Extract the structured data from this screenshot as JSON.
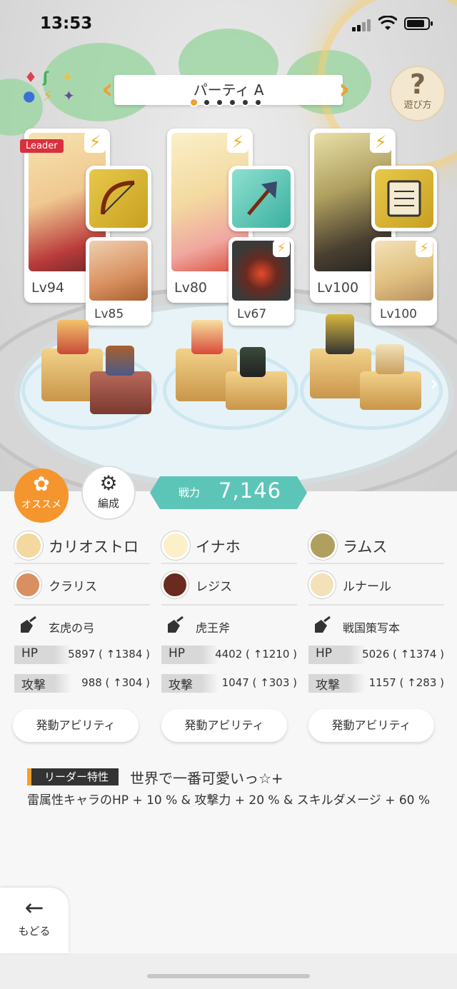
{
  "status_bar": {
    "time": "13:53"
  },
  "party": {
    "name": "パーティ A",
    "page_index": 1,
    "page_count": 6,
    "help_label": "遊び方",
    "prev_symbol": "‹",
    "next_symbol": "›",
    "help_symbol": "?"
  },
  "leader_tag": "Leader",
  "power": {
    "label": "戦力",
    "value": "7,146"
  },
  "buttons": {
    "recommend": "オススメ",
    "formation": "編成",
    "back": "もどる",
    "ability": "発動アビリティ"
  },
  "units": [
    {
      "name": "カリオストロ",
      "level": "Lv94",
      "sub_name": "クラリス",
      "sub_level": "Lv85",
      "weapon": "玄虎の弓",
      "hp_label": "HP",
      "hp": "5897 ( ↑1384 )",
      "atk_label": "攻撃",
      "atk": "988 ( ↑304 )"
    },
    {
      "name": "イナホ",
      "level": "Lv80",
      "sub_name": "レジス",
      "sub_level": "Lv67",
      "weapon": "虎王斧",
      "hp_label": "HP",
      "hp": "4402 ( ↑1210 )",
      "atk_label": "攻撃",
      "atk": "1047 ( ↑303 )"
    },
    {
      "name": "ラムス",
      "level": "Lv100",
      "sub_name": "ルナール",
      "sub_level": "Lv100",
      "weapon": "戦国策写本",
      "hp_label": "HP",
      "hp": "5026 ( ↑1374 )",
      "atk_label": "攻撃",
      "atk": "1157 ( ↑283 )"
    }
  ],
  "leader_skill": {
    "label": "リーダー特性",
    "name": "世界で一番可愛いっ☆+",
    "description": "雷属性キャラのHP + 10 % & 攻撃力 + 20 % & スキルダメージ + 60 %"
  },
  "icons": {
    "element": "bolt-icon",
    "weapon": "weapon-icon",
    "back": "arrow-left-icon",
    "help": "question-icon"
  },
  "colors": {
    "accent": "#f0a030",
    "power": "#5dc5b8",
    "leader_tag": "#d9303d",
    "recommend": "#f4962d"
  }
}
